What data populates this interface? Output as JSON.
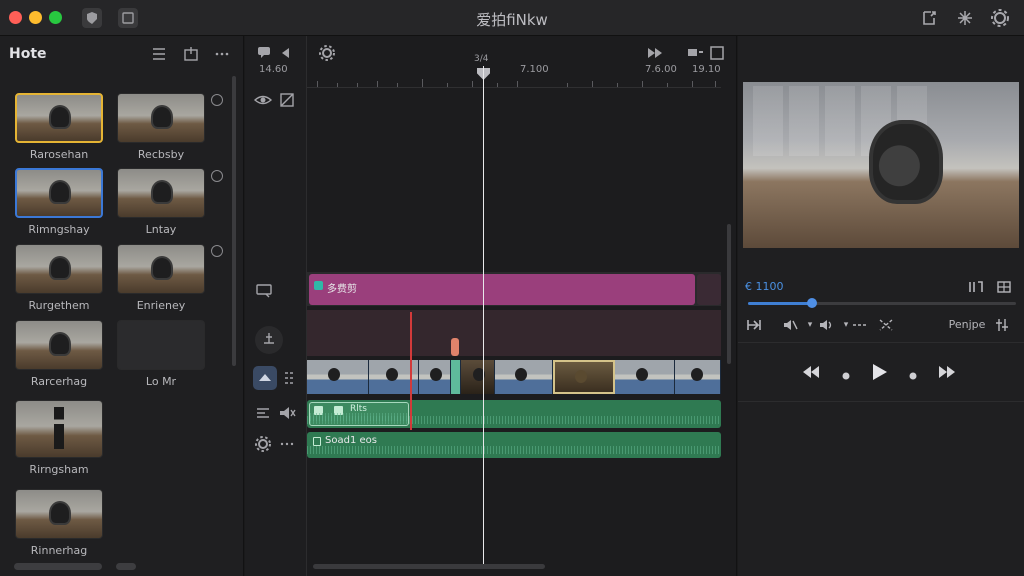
{
  "window": {
    "title": "爱拍fiNkw"
  },
  "browser": {
    "title": "Hote",
    "clips": [
      {
        "label": "Rarosehan",
        "kind": "headphones",
        "selection": "yellow"
      },
      {
        "label": "Recbsby",
        "kind": "headphones"
      },
      {
        "label": "Rimngshay",
        "kind": "headphones",
        "selection": "blue"
      },
      {
        "label": "Lntay",
        "kind": "headphones"
      },
      {
        "label": "Rurgethem",
        "kind": "headphones"
      },
      {
        "label": "Enrieney",
        "kind": "headphones"
      },
      {
        "label": "Rarcerhag",
        "kind": "headphones"
      },
      {
        "label": "Lo Mr",
        "kind": "empty"
      },
      {
        "label": "Rirngsham",
        "kind": "tripod"
      },
      {
        "label": "Rinnerhag",
        "kind": "headphones"
      }
    ]
  },
  "timeline": {
    "timecodes": {
      "left": "14.60",
      "playhead": "3/4",
      "mid": "7.100",
      "right_a": "7.6.00",
      "right_b": "19.10"
    },
    "title_clip_label": "多费剪",
    "audio_clip_a_label": "Rlts",
    "audio_clip_b_label": "Soad1 eos"
  },
  "viewer": {
    "timecode": "€ 1100",
    "mode_label": "Penjpe",
    "playhead_progress": 0.24
  },
  "colors": {
    "accent": "#3f7fd4",
    "title_clip": "#9a3f7c",
    "video_clip": "#4f6f9a",
    "audio_clip": "#2f7a52",
    "playhead_marker": "#d23a3a"
  }
}
